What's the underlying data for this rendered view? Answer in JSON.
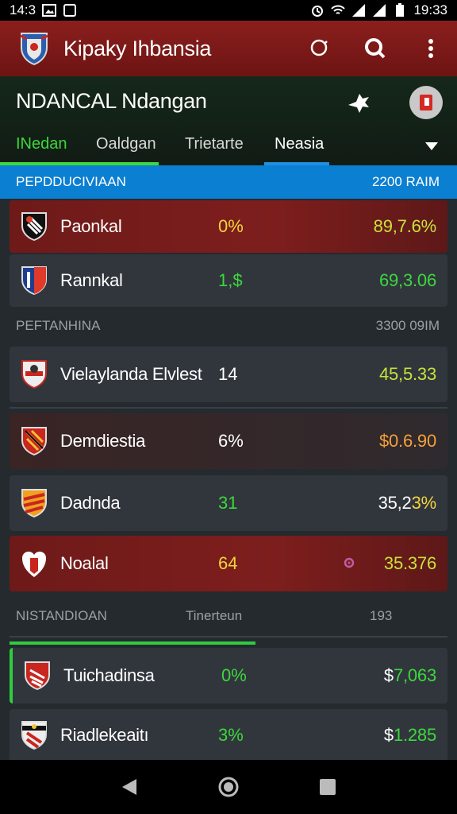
{
  "status_bar": {
    "time_left": "14:3",
    "time_right": "19:33"
  },
  "app_bar": {
    "title": "Kipaky Ihbansia"
  },
  "sub_header": {
    "title": "NDANCAL Ndangan",
    "tabs": [
      {
        "label": "INedan"
      },
      {
        "label": "Oaldgan"
      },
      {
        "label": "Trietarte"
      },
      {
        "label": "Neasia"
      }
    ]
  },
  "section": {
    "left": "PEPDDUCIVIAAN",
    "right": "2200 RAIM"
  },
  "group_one": {
    "left": "PEFTANHINA",
    "right": "3300 09IM"
  },
  "group_two": {
    "left": "NISTANDIOAN",
    "middle": "Tinerteun",
    "right": "193"
  },
  "rows": [
    {
      "name": "Paonkal",
      "stat": "0%",
      "value": "89,7.6%"
    },
    {
      "name": "Rannkal",
      "stat": "1,$",
      "value": "69,3.06"
    },
    {
      "name": "Vielaylanda Elvlest",
      "stat": "14",
      "value": "45,5.33"
    },
    {
      "name": "Demdiestia",
      "stat": "6%",
      "value": "$0.6.90"
    },
    {
      "name": "Dadnda",
      "stat": "31",
      "value_a": "35,2",
      "value_b": "3%"
    },
    {
      "name": "Noalal",
      "stat": "64",
      "value": "35.376"
    },
    {
      "name": "Tuichadinsa",
      "stat": "0%",
      "value_a": "$",
      "value_b": "7,063"
    },
    {
      "name": "Riadlekeaitı",
      "stat": "3%",
      "value_a": "$",
      "value_b": "1.285"
    }
  ],
  "colors": {
    "app_bar": "#8a1f1d",
    "section_bar": "#0b7fd2",
    "accent_green": "#3cd83c",
    "accent_yellow": "#f2d43d",
    "accent_orange": "#f5a03a",
    "list_bg": "#252a2f"
  },
  "icons": {
    "app_logo": "team-crest-icon",
    "action_1": "search-outline-icon",
    "action_2": "search-icon",
    "action_3": "more-vert-icon",
    "pin": "pin-star-icon",
    "avatar": "avatar-icon"
  }
}
